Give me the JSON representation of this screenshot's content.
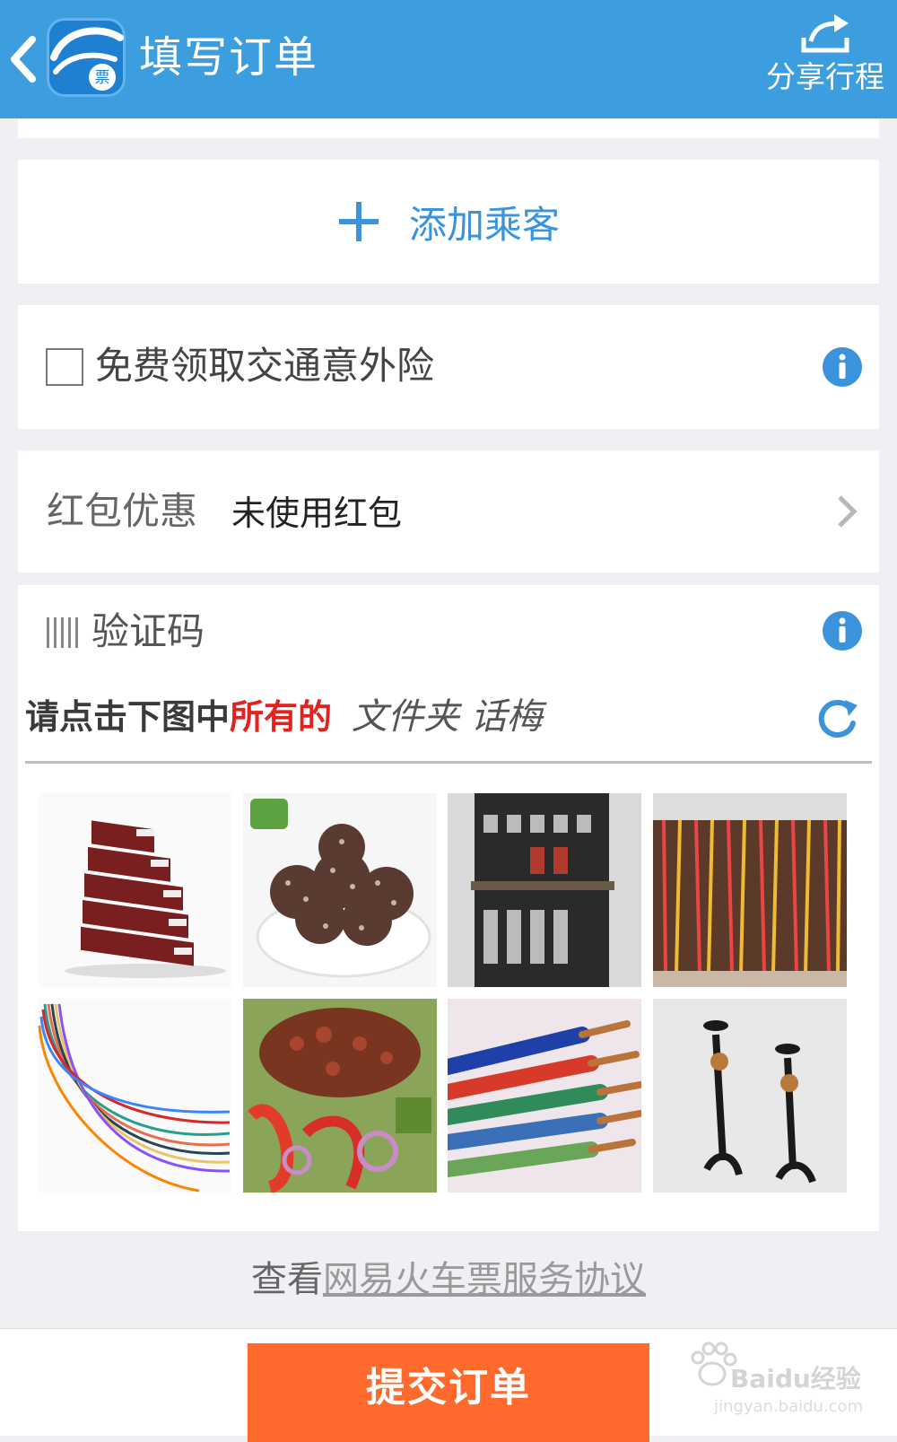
{
  "header": {
    "title": "填写订单",
    "share_label": "分享行程",
    "logo_text": "票"
  },
  "passenger": {
    "add_label": "添加乘客"
  },
  "insurance": {
    "label": "免费领取交通意外险",
    "checked": false
  },
  "red_packet": {
    "label": "红包优惠",
    "value": "未使用红包"
  },
  "captcha": {
    "title": "验证码",
    "prompt_dark": "请点击下图中",
    "prompt_red": "所有的",
    "prompt_hand": "文件夹  话梅",
    "images": [
      "folders-stack",
      "dried-plum-snack",
      "folders-shelf",
      "wire-bundle",
      "colored-wires",
      "meat-salad",
      "cables",
      "candle-holders"
    ]
  },
  "agreement": {
    "prefix": "查看",
    "link": "网易火车票服务协议"
  },
  "footer": {
    "submit_label": "提交订单",
    "watermark": "Baidu经验",
    "watermark_sub": "jingyan.baidu.com"
  },
  "colors": {
    "header": "#3c9ede",
    "accent": "#3a93db",
    "submit": "#ff6a2c",
    "red": "#e3211e"
  }
}
